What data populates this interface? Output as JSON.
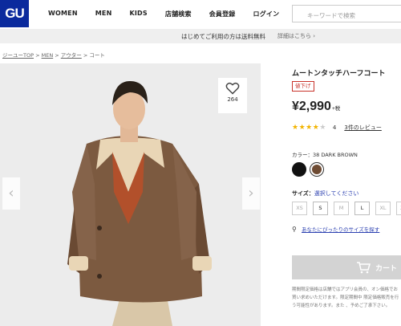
{
  "header": {
    "logo": "GU",
    "nav": [
      "WOMEN",
      "MEN",
      "KIDS",
      "店舗検索",
      "会員登録",
      "ログイン"
    ],
    "search_placeholder": "キーワードで検索"
  },
  "notice": {
    "message": "はじめてご利用の方は送料無料",
    "link": "詳細はこちら ›"
  },
  "breadcrumb": [
    "ジーユーTOP",
    "MEN",
    "アウター",
    "コート"
  ],
  "gallery": {
    "favorite_count": "264",
    "prev": "‹",
    "next": "›"
  },
  "product": {
    "name": "ムートンタッチハーフコート",
    "badge": "値下げ",
    "price": "¥2,990",
    "tax": "+税",
    "rating": 4,
    "rating_count": "4",
    "reviews_link": "3件のレビュー",
    "color_label": "カラー：38 DARK BROWN",
    "colors": [
      "#111111",
      "#6e4b33"
    ],
    "size_title": "サイズ：",
    "size_selection": "選択してください",
    "sizes": [
      "XS",
      "S",
      "M",
      "L",
      "XL",
      "XX"
    ],
    "size_available": [
      false,
      true,
      false,
      true,
      false,
      false
    ],
    "fit_link": "あなたにぴったりのサイズを探す",
    "cart_label": "カート",
    "note": "期間限定価格は店舗ではアプリ会員の、オン価格でお買い求めいただけます。限定期間中 限定価格販売を行う可能性があります。また 、予めご了承下さい。"
  }
}
